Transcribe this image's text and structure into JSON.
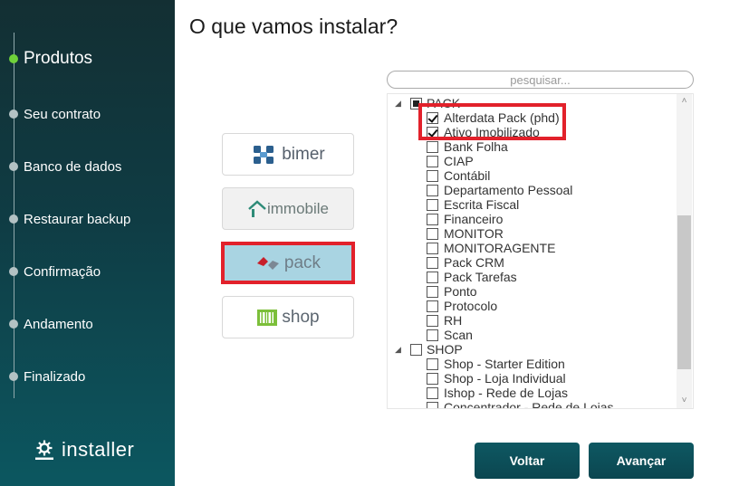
{
  "title": "O que vamos instalar?",
  "sidebar": {
    "steps": [
      {
        "label": "Produtos",
        "active": true
      },
      {
        "label": "Seu contrato"
      },
      {
        "label": "Banco de dados"
      },
      {
        "label": "Restaurar backup"
      },
      {
        "label": "Confirmação"
      },
      {
        "label": "Andamento"
      },
      {
        "label": "Finalizado"
      }
    ],
    "brand": "installer"
  },
  "products": [
    {
      "name": "bimer",
      "selected": false
    },
    {
      "name": "immobile",
      "selected": false
    },
    {
      "name": "pack",
      "selected": true
    },
    {
      "name": "shop",
      "selected": false
    }
  ],
  "search": {
    "placeholder": "pesquisar..."
  },
  "tree": {
    "groups": [
      {
        "label": "PACK",
        "state": "partial",
        "expander": "◢",
        "items": [
          {
            "label": "Alterdata Pack (phd)",
            "checked": true
          },
          {
            "label": "Ativo Imobilizado",
            "checked": true
          },
          {
            "label": "Bank Folha",
            "checked": false
          },
          {
            "label": "CIAP",
            "checked": false
          },
          {
            "label": "Contábil",
            "checked": false
          },
          {
            "label": "Departamento Pessoal",
            "checked": false
          },
          {
            "label": "Escrita Fiscal",
            "checked": false
          },
          {
            "label": "Financeiro",
            "checked": false
          },
          {
            "label": "MONITOR",
            "checked": false
          },
          {
            "label": "MONITORAGENTE",
            "checked": false
          },
          {
            "label": "Pack CRM",
            "checked": false
          },
          {
            "label": "Pack Tarefas",
            "checked": false
          },
          {
            "label": "Ponto",
            "checked": false
          },
          {
            "label": "Protocolo",
            "checked": false
          },
          {
            "label": "RH",
            "checked": false
          },
          {
            "label": "Scan",
            "checked": false
          }
        ]
      },
      {
        "label": "SHOP",
        "state": "unchecked",
        "expander": "◢",
        "items": [
          {
            "label": "Shop - Starter Edition",
            "checked": false
          },
          {
            "label": "Shop - Loja Individual",
            "checked": false
          },
          {
            "label": "Ishop - Rede de Lojas",
            "checked": false
          },
          {
            "label": "Concentrador - Rede de Lojas",
            "checked": false
          }
        ]
      }
    ]
  },
  "buttons": {
    "back": "Voltar",
    "next": "Avançar"
  },
  "colors": {
    "accent": "#0e5862",
    "active_step": "#6fd13a",
    "highlight": "#e2212b",
    "selected_card": "#a9d4e2"
  }
}
